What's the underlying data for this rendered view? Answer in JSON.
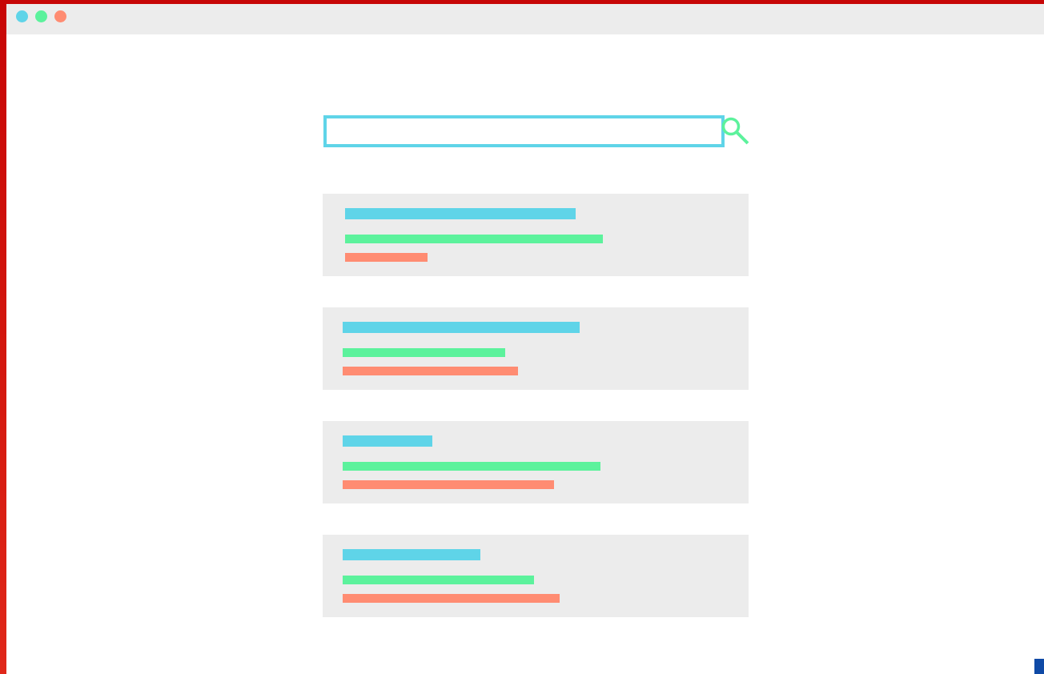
{
  "window": {
    "controls": [
      {
        "name": "close",
        "color": "#5fd4e8"
      },
      {
        "name": "minimize",
        "color": "#5cf29c"
      },
      {
        "name": "maximize",
        "color": "#ff8c72"
      }
    ]
  },
  "search": {
    "value": "",
    "placeholder": "",
    "border_color": "#5fd4e8",
    "icon": "search-icon",
    "icon_color": "#5cf29c"
  },
  "colors": {
    "title_bar_color": "#5fd4e8",
    "link_bar_color": "#5cf29c",
    "snippet_bar_color": "#ff8c72",
    "card_background": "#ececec",
    "frame_color": "#c80c0c"
  },
  "results": [
    {
      "title": "",
      "link": "",
      "snippet": ""
    },
    {
      "title": "",
      "link": "",
      "snippet": ""
    },
    {
      "title": "",
      "link": "",
      "snippet": ""
    },
    {
      "title": "",
      "link": "",
      "snippet": ""
    }
  ]
}
